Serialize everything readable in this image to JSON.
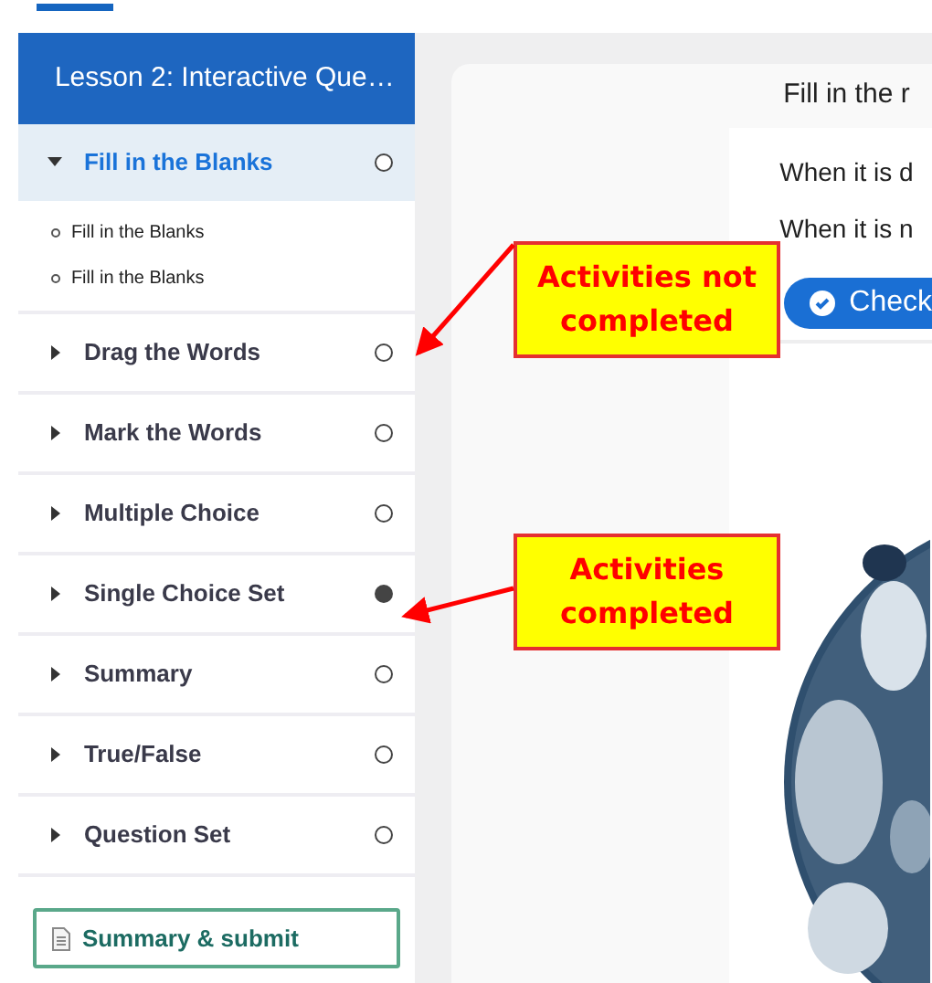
{
  "lesson_title": "Lesson 2: Interactive Que…",
  "sidebar": {
    "items": [
      {
        "label": "Fill in the Blanks",
        "expanded": true,
        "completed": false,
        "children": [
          {
            "label": "Fill in the Blanks"
          },
          {
            "label": "Fill in the Blanks"
          }
        ]
      },
      {
        "label": "Drag the Words",
        "expanded": false,
        "completed": false
      },
      {
        "label": "Mark the Words",
        "expanded": false,
        "completed": false
      },
      {
        "label": "Multiple Choice",
        "expanded": false,
        "completed": false
      },
      {
        "label": "Single Choice Set",
        "expanded": false,
        "completed": true
      },
      {
        "label": "Summary",
        "expanded": false,
        "completed": false
      },
      {
        "label": "True/False",
        "expanded": false,
        "completed": false
      },
      {
        "label": "Question Set",
        "expanded": false,
        "completed": false
      }
    ],
    "submit_button": "Summary & submit"
  },
  "content": {
    "title": "Fill in the r",
    "lines": [
      "When it is d",
      "When it is n"
    ],
    "check_button": "Check"
  },
  "annotations": [
    {
      "text": "Activities not completed"
    },
    {
      "text": "Activities completed"
    }
  ]
}
